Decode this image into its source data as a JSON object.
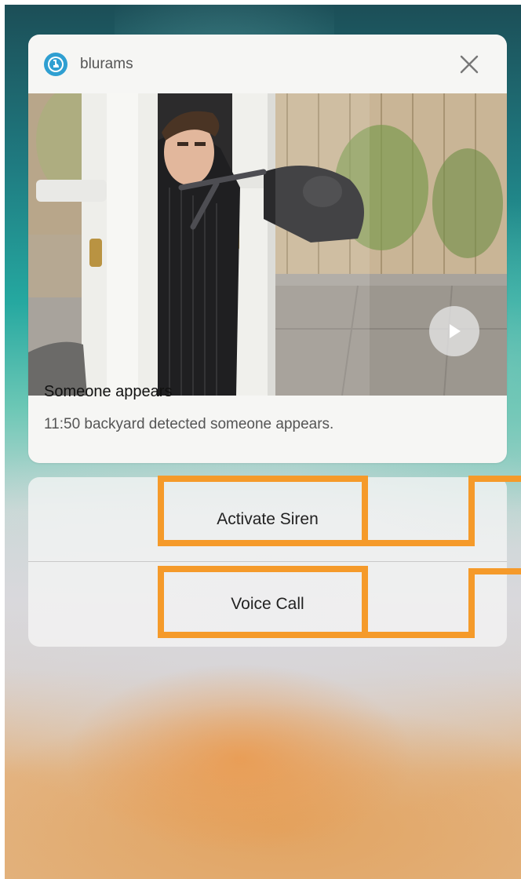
{
  "notification": {
    "app_name": "blurams",
    "title": "Someone appears",
    "body": "11:50 backyard detected someone appears.",
    "close_icon": "close-icon",
    "play_icon": "play-icon",
    "app_icon": "blurams-logo-icon"
  },
  "actions": [
    {
      "label": "Activate Siren"
    },
    {
      "label": "Voice Call"
    }
  ],
  "colors": {
    "highlight": "#f59a2a",
    "app_icon": "#2f9fd1"
  }
}
